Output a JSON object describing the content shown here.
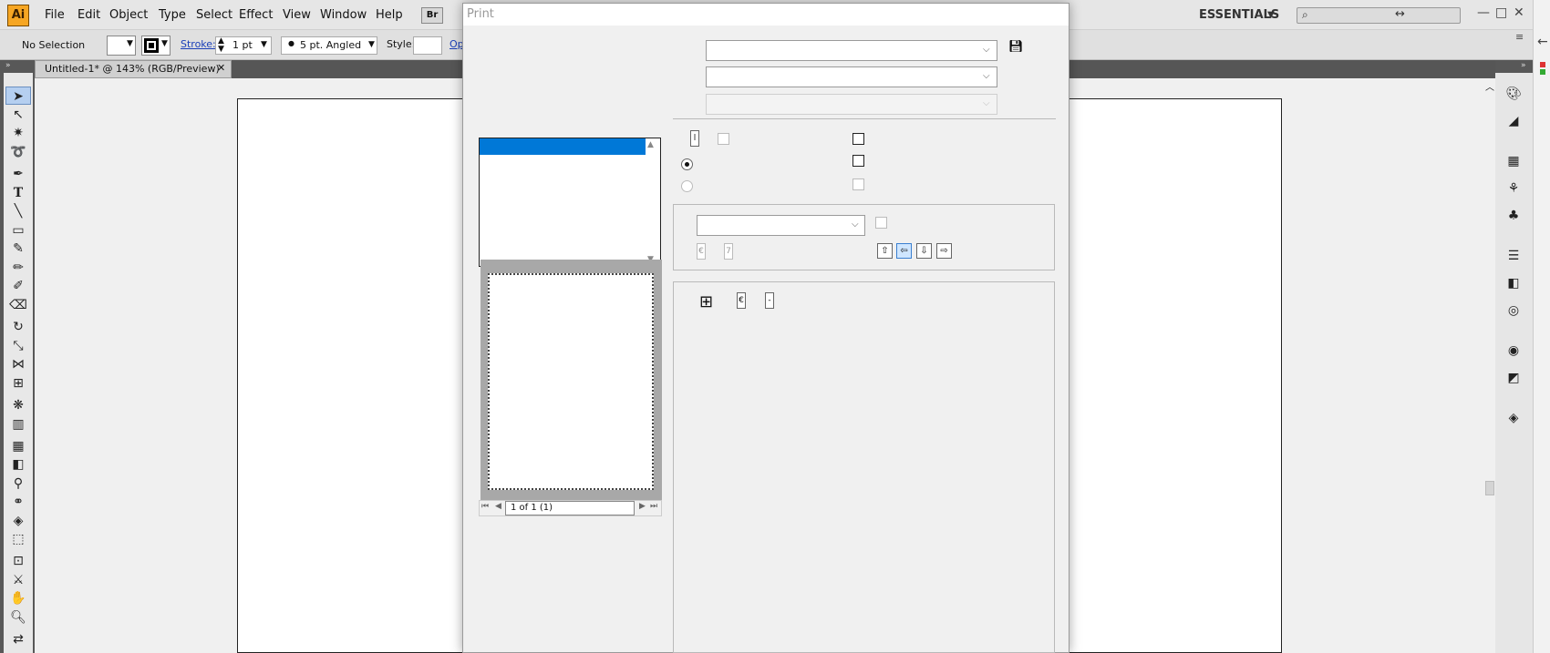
{
  "app": {
    "logo_text": "Ai"
  },
  "menubar": {
    "items": [
      "File",
      "Edit",
      "Object",
      "Type",
      "Select",
      "Effect",
      "View",
      "Window",
      "Help"
    ],
    "bridge_label": "Br",
    "workspace_label": "ESSENTIALS"
  },
  "controlbar": {
    "selection_label": "No Selection",
    "stroke_label": "Stroke:",
    "stroke_value": "1 pt",
    "brush_value": "5 pt. Angled",
    "style_label": "Style:",
    "opacity_label": "Op"
  },
  "document_tab": {
    "title": "Untitled-1* @ 143% (RGB/Preview)"
  },
  "print_dialog": {
    "title": "Print",
    "pager_text": "1 of 1 (1)",
    "range_field_text": "l",
    "scale_field_1": "€",
    "scale_field_2": "7",
    "placement_field_1": "€",
    "placement_field_2": "-"
  },
  "colors": {
    "selection_blue": "#0078d7",
    "logo_orange": "#f6a623"
  }
}
